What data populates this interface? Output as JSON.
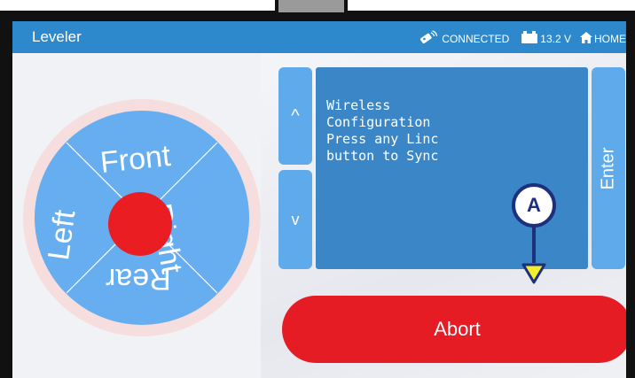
{
  "header": {
    "app_title": "Leveler",
    "connection_status": "CONNECTED",
    "battery_voltage": "13.2 V",
    "home_label": "HOME"
  },
  "directional_pad": {
    "front_label": "Front",
    "right_label": "Right",
    "rear_label": "Rear",
    "left_label": "Left"
  },
  "menu": {
    "up_label": "^",
    "down_label": "v",
    "enter_label": "Enter",
    "display_lines": [
      "Wireless",
      "Configuration",
      "Press any Linc",
      "button to Sync"
    ]
  },
  "actions": {
    "abort_label": "Abort"
  },
  "annotation": {
    "callout_label": "A"
  },
  "colors": {
    "header_blue": "#2d89cc",
    "button_blue": "#5eaaeb",
    "display_blue": "#3b86c6",
    "abort_red": "#e61c24",
    "callout_navy": "#1e2f7c",
    "arrow_yellow": "#f4ef2a"
  },
  "icons": [
    "connected-wireless-icon",
    "battery-icon",
    "home-icon",
    "arrow-down-icon"
  ]
}
